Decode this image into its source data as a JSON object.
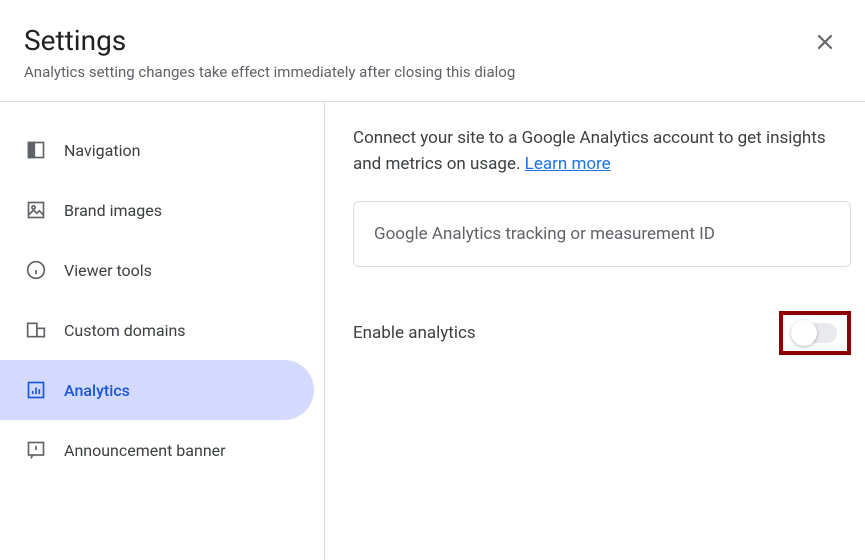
{
  "header": {
    "title": "Settings",
    "subtitle": "Analytics setting changes take effect immediately after closing this dialog"
  },
  "sidebar": {
    "items": [
      {
        "label": "Navigation"
      },
      {
        "label": "Brand images"
      },
      {
        "label": "Viewer tools"
      },
      {
        "label": "Custom domains"
      },
      {
        "label": "Analytics"
      },
      {
        "label": "Announcement banner"
      }
    ]
  },
  "main": {
    "description_prefix": "Connect your site to a Google Analytics account to get insights and metrics on usage. ",
    "learn_more": "Learn more",
    "tracking_placeholder": "Google Analytics tracking or measurement ID",
    "enable_label": "Enable analytics"
  }
}
